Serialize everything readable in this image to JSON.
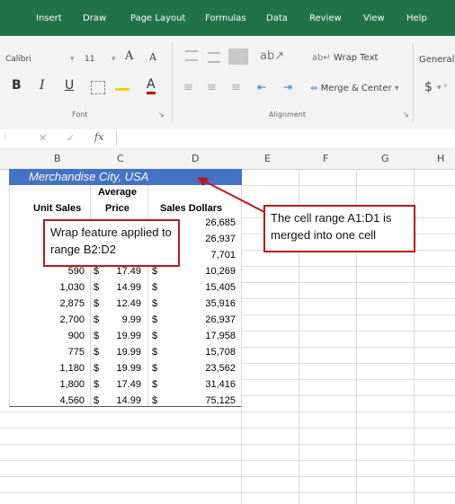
{
  "ribbon_tabs": [
    "Insert",
    "Draw",
    "Page Layout",
    "Formulas",
    "Data",
    "Review",
    "View",
    "Help"
  ],
  "font": {
    "name": "Calibri",
    "size": "11",
    "group_label": "Font"
  },
  "alignment": {
    "wrap_text": "Wrap Text",
    "merge_center": "Merge & Center",
    "group_label": "Alignment"
  },
  "number": {
    "format": "General",
    "currency": "$"
  },
  "formula_bar": {
    "fx": "fx"
  },
  "columns": [
    "B",
    "C",
    "D",
    "E",
    "F",
    "G",
    "H"
  ],
  "title_cell": "Merchandise City, USA",
  "headers": {
    "average": "Average",
    "price": "Price",
    "unit_sales": "Unit Sales",
    "sales_dollars": "Sales Dollars"
  },
  "rows": [
    {
      "units": "",
      "price": "",
      "dollars": "26,685"
    },
    {
      "units": "",
      "price": "",
      "dollars": "26,937"
    },
    {
      "units": "",
      "price": "",
      "dollars": "7,701"
    },
    {
      "units": "590",
      "price": "17.49",
      "dollars": "10,269"
    },
    {
      "units": "1,030",
      "price": "14.99",
      "dollars": "15,405"
    },
    {
      "units": "2,875",
      "price": "12.49",
      "dollars": "35,916"
    },
    {
      "units": "2,700",
      "price": "9.99",
      "dollars": "26,937"
    },
    {
      "units": "900",
      "price": "19.99",
      "dollars": "17,958"
    },
    {
      "units": "775",
      "price": "19.99",
      "dollars": "15,708"
    },
    {
      "units": "1,180",
      "price": "19.99",
      "dollars": "23,562"
    },
    {
      "units": "1,800",
      "price": "17.49",
      "dollars": "31,416"
    },
    {
      "units": "4,560",
      "price": "14.99",
      "dollars": "75,125"
    }
  ],
  "currency_symbol": "$",
  "callouts": {
    "wrap": "Wrap feature applied to range B2:D2",
    "merge": "The cell range A1:D1 is merged into one cell"
  },
  "colors": {
    "excel_green": "#217346",
    "title_fill": "#4472c4",
    "callout_border": "#c0141c"
  }
}
